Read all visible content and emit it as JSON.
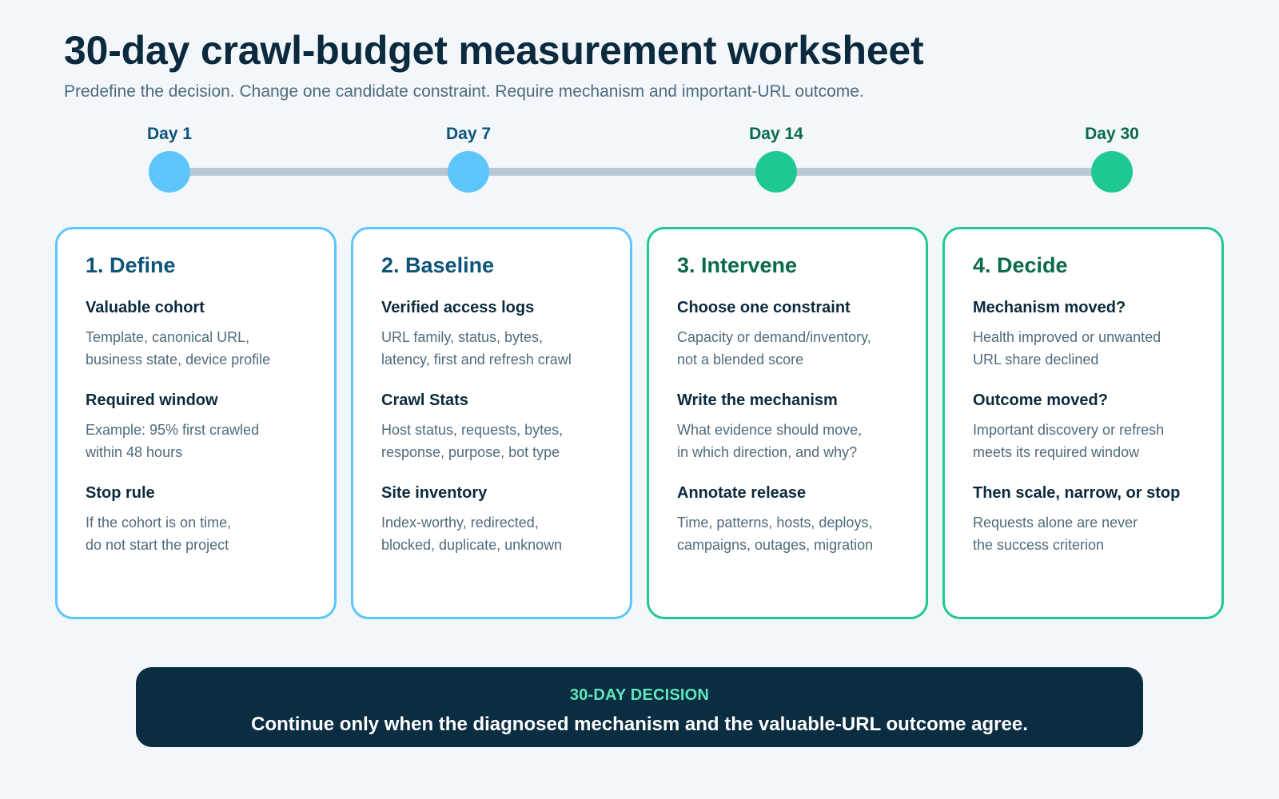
{
  "header": {
    "title": "30-day crawl-budget measurement worksheet",
    "subtitle": "Predefine the decision. Change one candidate constraint. Require mechanism and important-URL outcome."
  },
  "timeline": {
    "milestones": [
      {
        "label": "Day 1",
        "color": "#5cc6fb"
      },
      {
        "label": "Day 7",
        "color": "#5cc6fb"
      },
      {
        "label": "Day 14",
        "color": "#1fc893"
      },
      {
        "label": "Day 30",
        "color": "#1fc893"
      }
    ],
    "line_color": "#b8c8d4"
  },
  "cards": [
    {
      "title": "1. Define",
      "accent": "#5cc6fb",
      "items": [
        {
          "heading": "Valuable cohort",
          "lines": [
            "Template, canonical URL,",
            "business state, device profile"
          ]
        },
        {
          "heading": "Required window",
          "lines": [
            "Example: 95% first crawled",
            "within 48 hours"
          ]
        },
        {
          "heading": "Stop rule",
          "lines": [
            "If the cohort is on time,",
            "do not start the project"
          ]
        }
      ]
    },
    {
      "title": "2. Baseline",
      "accent": "#5cc6fb",
      "items": [
        {
          "heading": "Verified access logs",
          "lines": [
            "URL family, status, bytes,",
            "latency, first and refresh crawl"
          ]
        },
        {
          "heading": "Crawl Stats",
          "lines": [
            "Host status, requests, bytes,",
            "response, purpose, bot type"
          ]
        },
        {
          "heading": "Site inventory",
          "lines": [
            "Index-worthy, redirected,",
            "blocked, duplicate, unknown"
          ]
        }
      ]
    },
    {
      "title": "3. Intervene",
      "accent": "#1fc893",
      "items": [
        {
          "heading": "Choose one constraint",
          "lines": [
            "Capacity or demand/inventory,",
            "not a blended score"
          ]
        },
        {
          "heading": "Write the mechanism",
          "lines": [
            "What evidence should move,",
            "in which direction, and why?"
          ]
        },
        {
          "heading": "Annotate release",
          "lines": [
            "Time, patterns, hosts, deploys,",
            "campaigns, outages, migration"
          ]
        }
      ]
    },
    {
      "title": "4. Decide",
      "accent": "#1fc893",
      "items": [
        {
          "heading": "Mechanism moved?",
          "lines": [
            "Health improved or unwanted",
            "URL share declined"
          ]
        },
        {
          "heading": "Outcome moved?",
          "lines": [
            "Important discovery or refresh",
            "meets its required window"
          ]
        },
        {
          "heading": "Then scale, narrow, or stop",
          "lines": [
            "Requests alone are never",
            "the success criterion"
          ]
        }
      ]
    }
  ],
  "banner": {
    "label": "30-DAY DECISION",
    "text": "Continue only when the diagnosed mechanism and the valuable-URL outcome agree."
  }
}
